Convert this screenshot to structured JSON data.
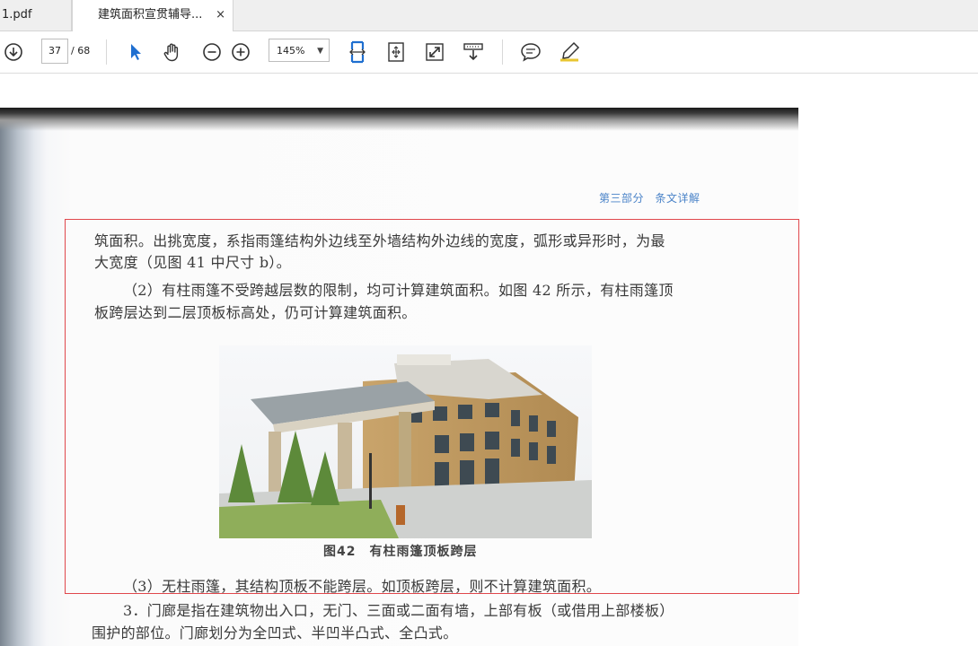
{
  "tabs": [
    {
      "label": "1.pdf",
      "active": false
    },
    {
      "label": "建筑面积宣贯辅导...",
      "active": true,
      "close": "×"
    }
  ],
  "toolbar": {
    "current_page": "37",
    "total_pages": "/ 68",
    "zoom": "145%",
    "zoom_caret": "▼",
    "icons": [
      "download-icon",
      "select-cursor-icon",
      "hand-tool-icon",
      "zoom-out-icon",
      "zoom-in-icon",
      "fit-width-icon",
      "fit-page-icon",
      "full-screen-icon",
      "scroll-mode-icon",
      "comment-icon",
      "highlight-pen-icon"
    ]
  },
  "colors": {
    "accent": "#1f6fd0",
    "header_blue": "#4a83c8",
    "selection_box": "#e0474c"
  },
  "document": {
    "header": "第三部分　条文详解",
    "paragraphs": [
      "筑面积。出挑宽度，系指雨篷结构外边线至外墙结构外边线的宽度，弧形或异形时，为最",
      "大宽度（见图 41 中尺寸 b）。",
      "（2）有柱雨篷不受跨越层数的限制，均可计算建筑面积。如图 42 所示，有柱雨篷顶",
      "板跨层达到二层顶板标高处，仍可计算建筑面积。"
    ],
    "figure_caption": "图42　有柱雨篷顶板跨层",
    "paragraphs_after": [
      "（3）无柱雨篷，其结构顶板不能跨层。如顶板跨层，则不计算建筑面积。",
      "3．门廊是指在建筑物出入口，无门、三面或二面有墙，上部有板（或借用上部楼板）",
      "围护的部位。门廊划分为全凹式、半凹半凸式、全凸式。"
    ]
  }
}
